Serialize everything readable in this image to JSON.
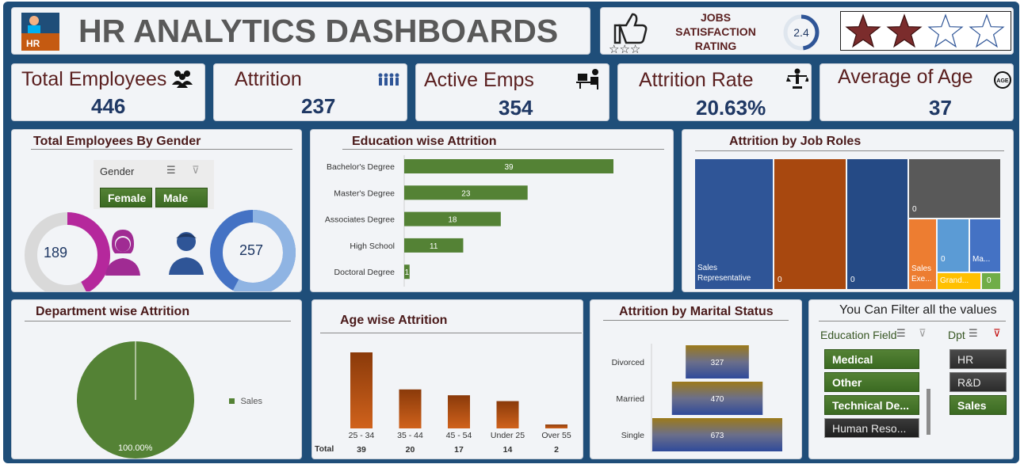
{
  "header": {
    "title": "HR ANALYTICS DASHBOARDS",
    "rating_label_1": "JOBS",
    "rating_label_2": "SATISFACTION",
    "rating_label_3": "RATING",
    "rating_value": "2.4",
    "rating_fraction": 0.48,
    "stars_filled": 2,
    "stars_total": 4
  },
  "kpis": [
    {
      "label": "Total Employees",
      "value": "446",
      "icon": "people-group-icon"
    },
    {
      "label": "Attrition",
      "value": "237",
      "icon": "people-leaving-icon"
    },
    {
      "label": "Active Emps",
      "value": "354",
      "icon": "person-at-desk-icon"
    },
    {
      "label": "Attrition Rate",
      "value": "20.63%",
      "icon": "balance-person-icon"
    },
    {
      "label": "Average of Age",
      "value": "37",
      "icon": "age-badge-icon"
    }
  ],
  "gender": {
    "title": "Total Employees By Gender",
    "slicer_label": "Gender",
    "options": [
      "Female",
      "Male"
    ],
    "female_value": "189",
    "male_value": "257"
  },
  "education_panel": {
    "title": "Education wise Attrition"
  },
  "jobrole_panel": {
    "title": "Attrition by Job Roles",
    "labels": [
      "Sales Representative",
      "0",
      "0",
      "0",
      "Sales Exe...",
      "0",
      "Ma...",
      "Grand...",
      "0"
    ]
  },
  "dept_panel": {
    "title": "Department wise Attrition",
    "legend": "Sales",
    "slice_label": "100.00%"
  },
  "age_panel": {
    "title": "Age wise Attrition",
    "total_label": "Total"
  },
  "marital_panel": {
    "title": "Attrition by Marital Status"
  },
  "filters": {
    "title": "You Can Filter all the values",
    "education_label": "Education Field",
    "education_options": [
      {
        "label": "Medical",
        "selected": true
      },
      {
        "label": "Other",
        "selected": true
      },
      {
        "label": "Technical De...",
        "selected": true
      },
      {
        "label": "Human Reso...",
        "selected": false
      }
    ],
    "dept_label": "Dpt",
    "dept_options": [
      {
        "label": "HR",
        "selected": false
      },
      {
        "label": "R&D",
        "selected": false
      },
      {
        "label": "Sales",
        "selected": true
      }
    ]
  },
  "colors": {
    "green": "#548235",
    "orange": "#c55a11",
    "navy": "#1f3864",
    "purple": "#a02b93",
    "blue": "#2f5597"
  },
  "chart_data": [
    {
      "type": "bar",
      "title": "Education wise Attrition",
      "categories": [
        "Bachelor's Degree",
        "Master's Degree",
        "Associates Degree",
        "High School",
        "Doctoral Degree"
      ],
      "values": [
        39,
        23,
        18,
        11,
        1
      ]
    },
    {
      "type": "bar",
      "title": "Age wise Attrition",
      "categories": [
        "25 - 34",
        "35 - 44",
        "45 - 54",
        "Under 25",
        "Over 55"
      ],
      "values": [
        39,
        20,
        17,
        14,
        2
      ]
    },
    {
      "type": "bar",
      "title": "Attrition by Marital Status",
      "categories": [
        "Divorced",
        "Married",
        "Single"
      ],
      "values": [
        327,
        470,
        673
      ]
    },
    {
      "type": "pie",
      "title": "Department wise Attrition",
      "categories": [
        "Sales"
      ],
      "values": [
        100.0
      ]
    },
    {
      "type": "pie",
      "title": "Total Employees By Gender",
      "categories": [
        "Female",
        "Male"
      ],
      "values": [
        189,
        257
      ]
    }
  ]
}
